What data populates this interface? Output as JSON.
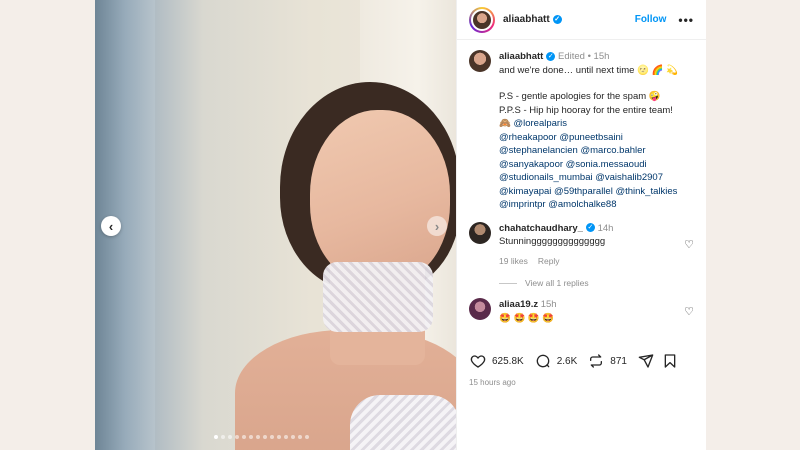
{
  "post": {
    "username": "aliaabhatt",
    "follow_label": "Follow",
    "more_label": "•••",
    "nav_prev": "‹",
    "nav_next": "›",
    "carousel_count": 14,
    "carousel_active": 0
  },
  "caption": {
    "username": "aliaabhatt",
    "edited": "Edited",
    "separator": "•",
    "time": "15h",
    "line1": "and we're done… until next time 🌝 🌈 💫",
    "line2": "P.S - gentle apologies for the spam 🤪",
    "line3": "P.P.S - Hip hip hooray for the entire team!",
    "mention_lines": [
      "🙈 @lorealparis",
      "@rheakapoor @puneetbsaini",
      "@stephanelancien @marco.bahler",
      "@sanyakapoor @sonia.messaoudi",
      "@studionails_mumbai @vaishalib2907",
      "@kimayapai @59thparallel @think_talkies",
      "@imprintpr @amolchalke88"
    ]
  },
  "comments": [
    {
      "username": "chahatchaudhary_",
      "time": "14h",
      "text": "Stunningggggggggggggg",
      "likes": "19 likes",
      "reply": "Reply",
      "view_replies": "View all 1 replies"
    },
    {
      "username": "aliaa19.z",
      "time": "15h",
      "text": "🤩 🤩 🤩 🤩"
    }
  ],
  "actions": {
    "likes": "625.8K",
    "comments": "2.6K",
    "reposts": "871",
    "posted_ago": "15 hours ago"
  },
  "colors": {
    "accent": "#0095f6",
    "mention": "#00376b",
    "muted": "#8e8e8e"
  }
}
